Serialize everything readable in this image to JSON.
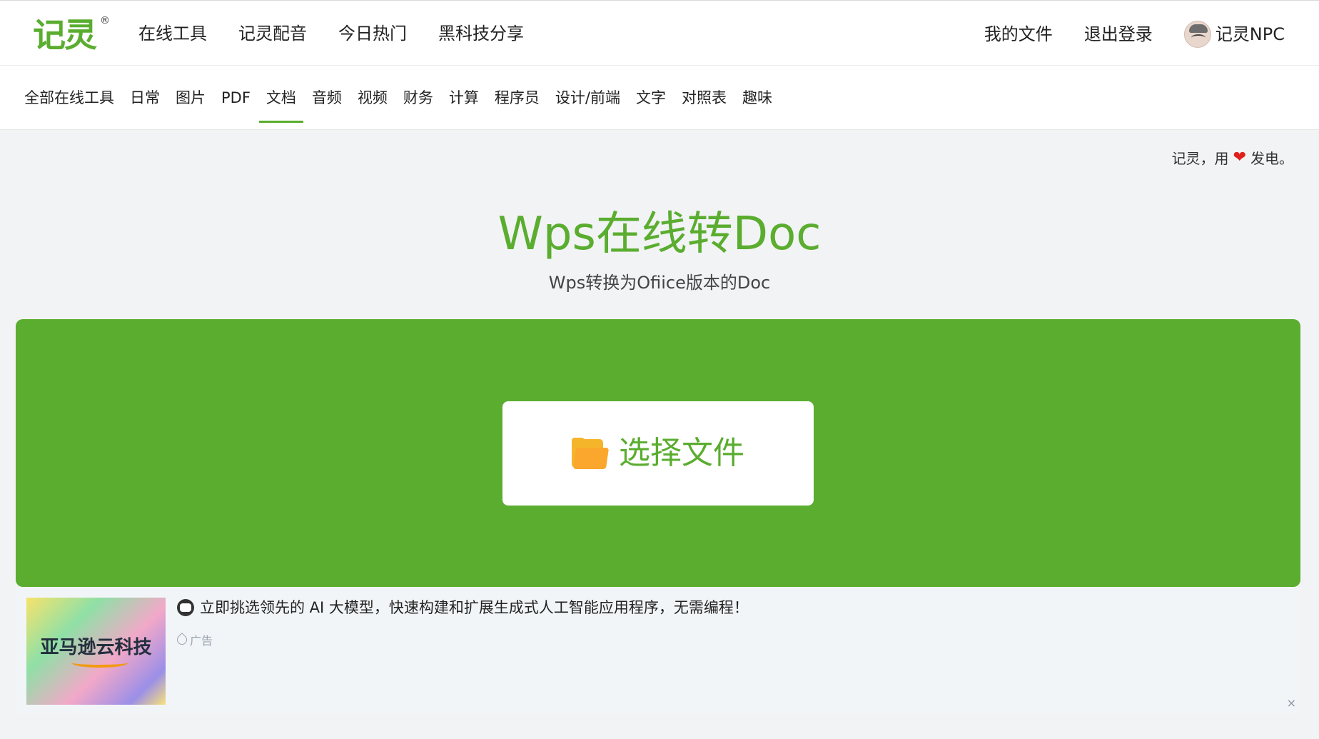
{
  "header": {
    "logo_text": "记灵",
    "logo_mark": "®",
    "nav": [
      "在线工具",
      "记灵配音",
      "今日热门",
      "黑科技分享"
    ],
    "my_files": "我的文件",
    "logout": "退出登录",
    "username": "记灵NPC"
  },
  "categories": {
    "items": [
      "全部在线工具",
      "日常",
      "图片",
      "PDF",
      "文档",
      "音频",
      "视频",
      "财务",
      "计算",
      "程序员",
      "设计/前端",
      "文字",
      "对照表",
      "趣味"
    ],
    "active": "文档"
  },
  "slogan": {
    "before": "记灵，用",
    "heart_icon": "heart-icon",
    "after": "发电。"
  },
  "tool": {
    "title": "Wps在线转Doc",
    "subtitle": "Wps转换为Ofiice版本的Doc",
    "choose_button": "选择文件",
    "button_icon": "folder-icon"
  },
  "ad": {
    "image_text": "亚马逊云科技",
    "text": "立即挑选领先的 AI 大模型，快速构建和扩展生成式人工智能应用程序，无需编程！",
    "tag": "广告",
    "close": "×"
  },
  "colors": {
    "accent": "#5aad2f",
    "heart": "#e0201a",
    "folder": "#f5b52a"
  }
}
